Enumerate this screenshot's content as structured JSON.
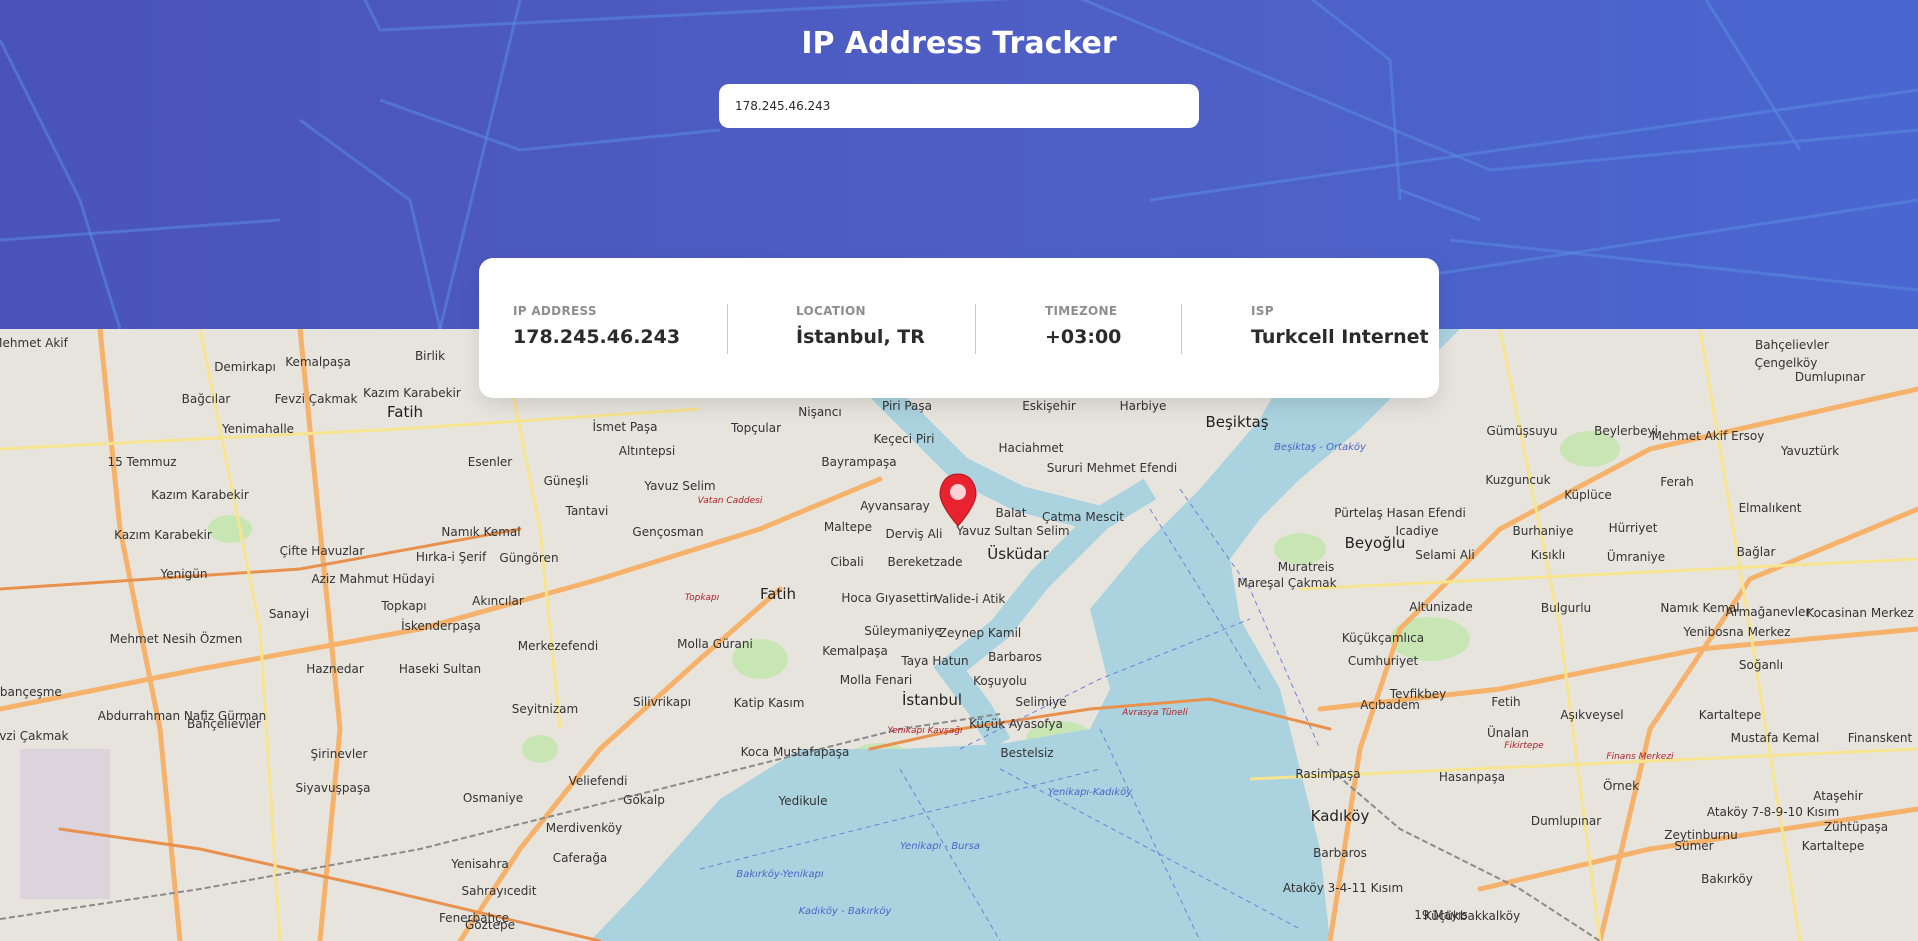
{
  "app": {
    "title": "IP Address Tracker"
  },
  "search": {
    "value": "178.245.46.243"
  },
  "info": {
    "ip_label": "IP ADDRESS",
    "ip_value": "178.245.46.243",
    "location_label": "LOCATION",
    "location_value": "İstanbul, TR",
    "timezone_label": "TIMEZONE",
    "timezone_value": "+03:00",
    "isp_label": "ISP",
    "isp_value": "Turkcell Internet"
  },
  "map": {
    "marker_icon": "location-pin-icon",
    "labels": [
      "Mehmet Akif",
      "Demirkapı",
      "Kemalpaşa",
      "Birlik",
      "Bağcılar",
      "Fevzi Çakmak",
      "Kazım Karabekir",
      "Yenimahalle",
      "Fatih",
      "İsmet Paşa",
      "Topçular",
      "Nişancı",
      "Piri Paşa",
      "Eskişehir",
      "Harbiye",
      "Beşiktaş",
      "Çengelköy",
      "Dumlupınar",
      "Bahçelievler",
      "15 Temmuz",
      "Esenler",
      "Altıntepsi",
      "Keçeci Piri",
      "Haciahmet",
      "Sururi Mehmet Efendi",
      "Gümüşsuyu",
      "Beylerbeyi",
      "Mehmet Akif Ersoy",
      "Yavuztürk",
      "Kazım Karabekir",
      "Güneşli",
      "Yavuz Selim",
      "Bayrampaşa",
      "Ayvansaray",
      "Balat",
      "Çatma Mescit",
      "Pürtelaş Hasan Efendi",
      "Kuzguncuk",
      "Küplüce",
      "Ferah",
      "Elmalıkent",
      "Tantavi",
      "Namık Kemal",
      "Gençosman",
      "Maltepe",
      "Derviş Ali",
      "Yavuz Sultan Selim",
      "Beyoğlu",
      "Icadiye",
      "Burhaniye",
      "Hürriyet",
      "Kazım Karabekir",
      "Çifte Havuzlar",
      "Güngören",
      "Hırka-i Şerif",
      "Cibali",
      "Bereketzade",
      "Üsküdar",
      "Selami Ali",
      "Kısıklı",
      "Ümraniye",
      "Bağlar",
      "Yenigün",
      "Aziz Mahmut Hüdayi",
      "Muratreis",
      "Mareşal Çakmak",
      "Topkapı",
      "Fatih",
      "Hoca Gıyasettin",
      "Valide-i Atik",
      "Altunizade",
      "Bulgurlu",
      "Namık Kemal",
      "Armağanevler",
      "Kocasinan Merkez",
      "Sanayi",
      "Akıncılar",
      "İskenderpaşa",
      "Süleymaniye",
      "Zeynep Kamil",
      "Küçükçamlıca",
      "Yenibosna Merkez",
      "Mehmet Nesih Özmen",
      "Merkezefendi",
      "Molla Gürani",
      "Kemalpaşa",
      "Taya Hatun",
      "Barbaros",
      "Cumhuriyet",
      "Soğanlı",
      "Haznedar",
      "Haseki Sultan",
      "Molla Fenari",
      "Koşuyolu",
      "Tevfikbey",
      "Çobançeşme",
      "Abdurrahman Nafiz Gürman",
      "Seyitnizam",
      "Silivrikapı",
      "Katip Kasım",
      "İstanbul",
      "Selimiye",
      "Acıbadem",
      "Fetih",
      "Aşıkveysel",
      "Kartaltepe",
      "Fevzi Çakmak",
      "Bahçelievler",
      "Küçük Ayasofya",
      "Ünalan",
      "Mustafa Kemal",
      "Finanskent",
      "Şirinevler",
      "Siyavuşpaşa",
      "Bestelsiz",
      "Koca Mustafapaşa",
      "Rasimpaşa",
      "Hasanpaşa",
      "Örnek",
      "Ataşehir",
      "Veliefendi",
      "Osmaniye",
      "Gökalp",
      "Yedikule",
      "Kadıköy",
      "Dumlupınar",
      "Zeytinburnu",
      "Ataköy 7-8-9-10 Kısım",
      "Zühtüpaşa",
      "Merdivenköy",
      "Yenisahra",
      "Barbaros",
      "Sümer",
      "Kartaltepe",
      "Caferağa",
      "Sahrayıcedit",
      "Ataköy 3-4-11 Kısım",
      "Bakırköy",
      "Fenerbahçe",
      "Göztepe",
      "19 Mayıs",
      "Küçükbakkalköy"
    ],
    "water_labels": [
      "Yenikapı-Kadıköy",
      "Bakırköy-Yenikapı",
      "Kadıköy - Bakırköy",
      "Yenikapı - Bursa",
      "Beşiktaş - Ortaköy"
    ],
    "road_labels": [
      "Vatan Caddesi",
      "Topkapı",
      "Yenikapı Kavşağı",
      "Avrasya Tüneli",
      "Fikirtepe",
      "Finans Merkezi"
    ]
  }
}
